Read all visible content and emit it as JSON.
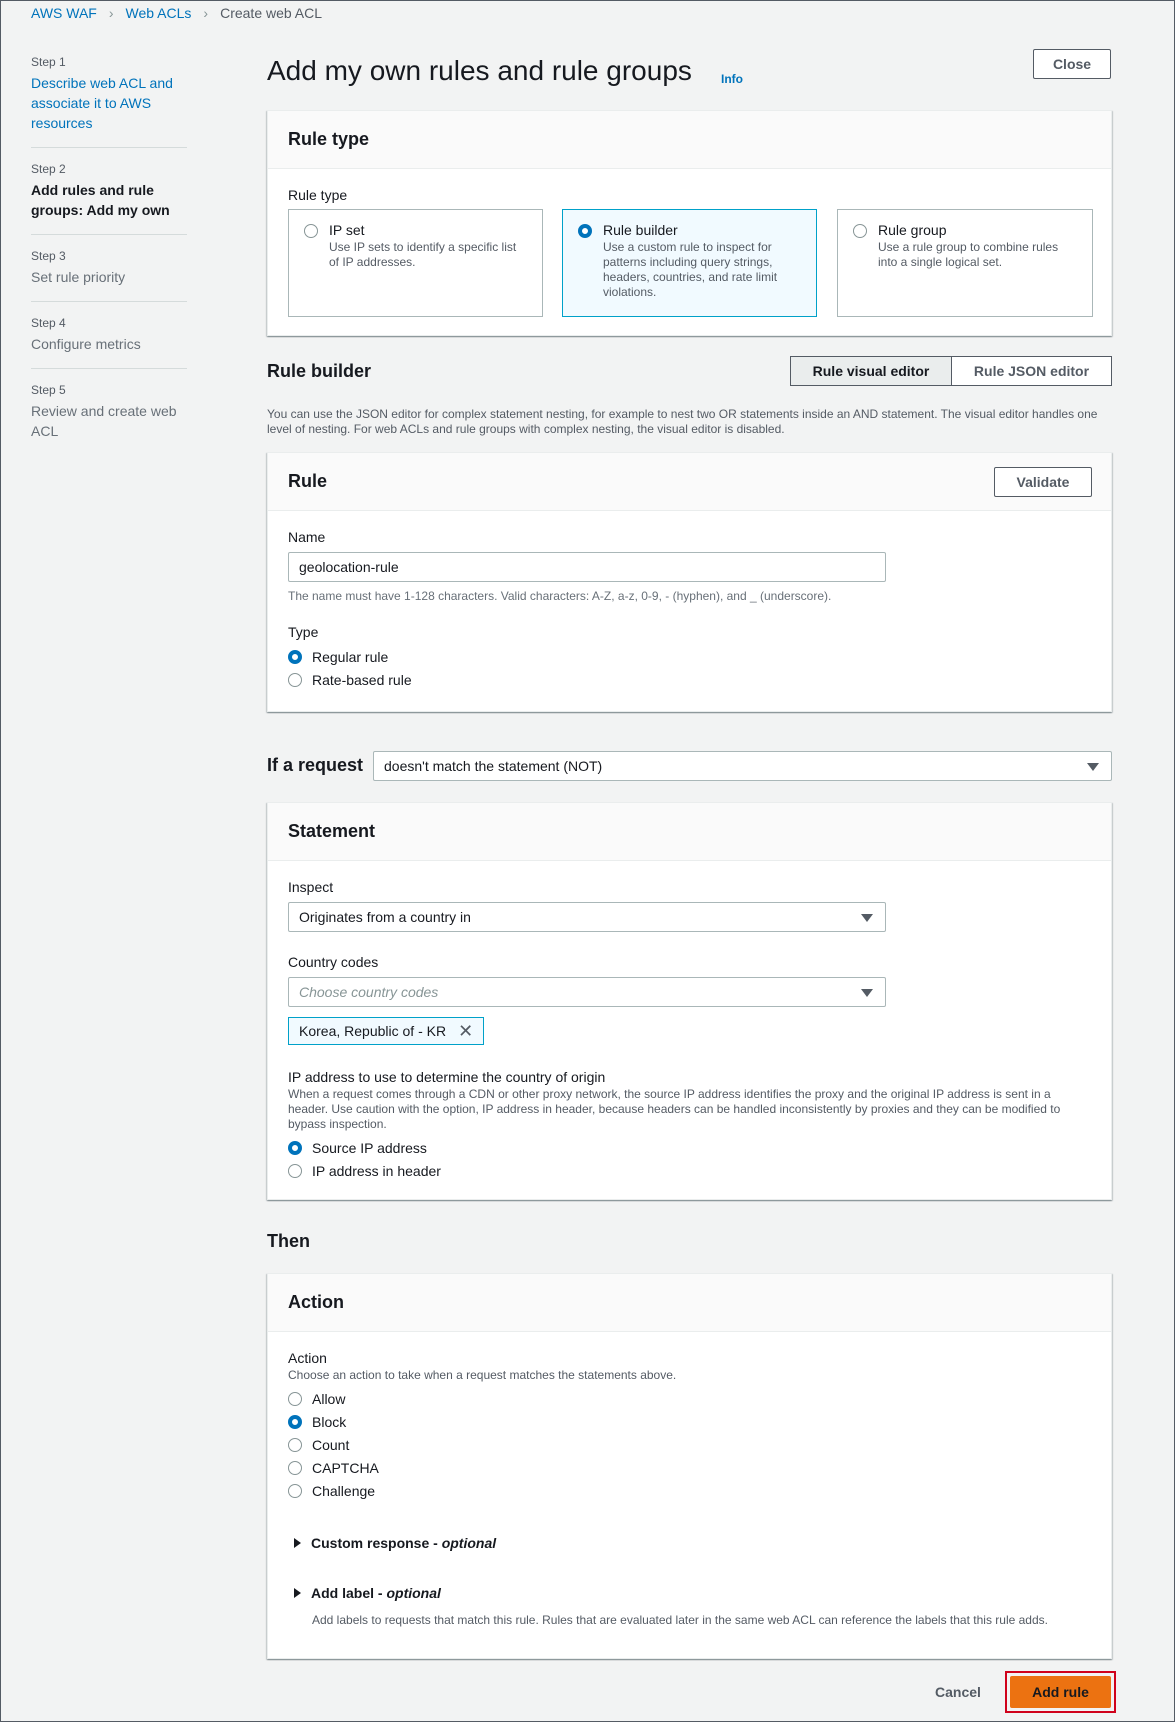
{
  "breadcrumb": [
    "AWS WAF",
    "Web ACLs",
    "Create web ACL"
  ],
  "steps": [
    {
      "num": "Step 1",
      "label": "Describe web ACL and associate it to AWS resources"
    },
    {
      "num": "Step 2",
      "label": "Add rules and rule groups: Add my own"
    },
    {
      "num": "Step 3",
      "label": "Set rule priority"
    },
    {
      "num": "Step 4",
      "label": "Configure metrics"
    },
    {
      "num": "Step 5",
      "label": "Review and create web ACL"
    }
  ],
  "page": {
    "title": "Add my own rules and rule groups",
    "info": "Info",
    "close": "Close"
  },
  "rule_type": {
    "heading": "Rule type",
    "label": "Rule type",
    "tiles": [
      {
        "title": "IP set",
        "desc": "Use IP sets to identify a specific list of IP addresses."
      },
      {
        "title": "Rule builder",
        "desc": "Use a custom rule to inspect for patterns including query strings, headers, countries, and rate limit violations."
      },
      {
        "title": "Rule group",
        "desc": "Use a rule group to combine rules into a single logical set."
      }
    ],
    "selected": "Rule builder"
  },
  "rule_builder": {
    "heading": "Rule builder",
    "visual": "Rule visual editor",
    "json": "Rule JSON editor",
    "desc": "You can use the JSON editor for complex statement nesting, for example to nest two OR statements inside an AND statement. The visual editor handles one level of nesting. For web ACLs and rule groups with complex nesting, the visual editor is disabled."
  },
  "rule": {
    "heading": "Rule",
    "validate": "Validate",
    "name_label": "Name",
    "name_value": "geolocation-rule",
    "name_hint": "The name must have 1-128 characters. Valid characters: A-Z, a-z, 0-9, - (hyphen), and _ (underscore).",
    "type_label": "Type",
    "type_options": [
      "Regular rule",
      "Rate-based rule"
    ],
    "type_selected": "Regular rule"
  },
  "if_request": {
    "label": "If a request",
    "value": "doesn't match the statement (NOT)"
  },
  "statement": {
    "heading": "Statement",
    "inspect_label": "Inspect",
    "inspect_value": "Originates from a country in",
    "country_label": "Country codes",
    "country_placeholder": "Choose country codes",
    "token": "Korea, Republic of - KR",
    "ip_label": "IP address to use to determine the country of origin",
    "ip_desc": "When a request comes through a CDN or other proxy network, the source IP address identifies the proxy and the original IP address is sent in a header. Use caution with the option, IP address in header, because headers can be handled inconsistently by proxies and they can be modified to bypass inspection.",
    "ip_options": [
      "Source IP address",
      "IP address in header"
    ],
    "ip_selected": "Source IP address"
  },
  "then": {
    "heading": "Then"
  },
  "action": {
    "heading": "Action",
    "label": "Action",
    "desc": "Choose an action to take when a request matches the statements above.",
    "options": [
      "Allow",
      "Block",
      "Count",
      "CAPTCHA",
      "Challenge"
    ],
    "selected": "Block",
    "custom_response": "Custom response",
    "add_label": "Add label",
    "optional": "optional",
    "dash": " - ",
    "add_label_desc": "Add labels to requests that match this rule. Rules that are evaluated later in the same web ACL can reference the labels that this rule adds."
  },
  "footer": {
    "cancel": "Cancel",
    "add_rule": "Add rule"
  },
  "colors": {
    "accent": "#0073bb",
    "primary": "#ec7211",
    "highlight": "#d0021b"
  }
}
